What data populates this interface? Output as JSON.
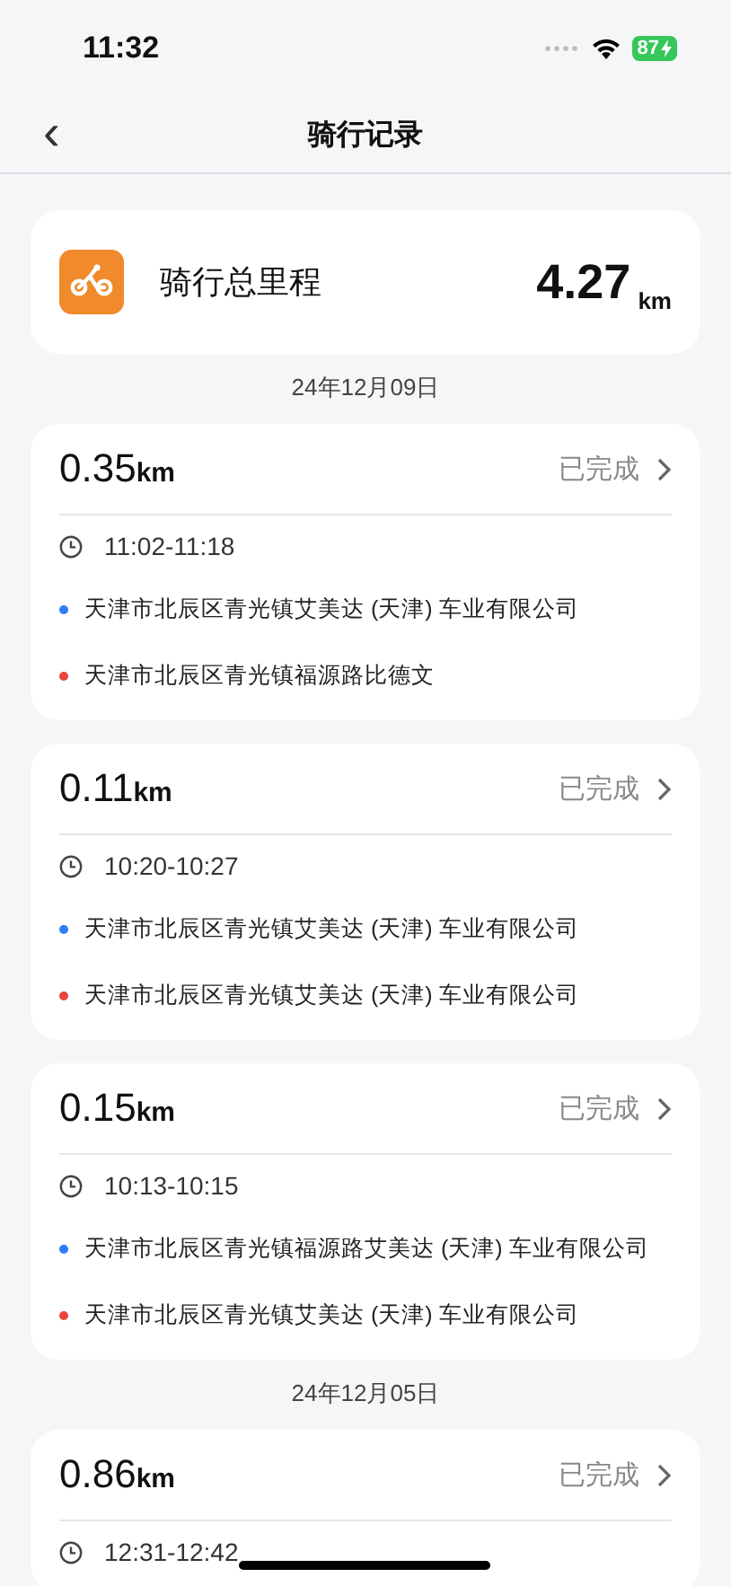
{
  "status_bar": {
    "time": "11:32",
    "battery": "87"
  },
  "nav": {
    "back": "‹",
    "title": "骑行记录"
  },
  "summary": {
    "label": "骑行总里程",
    "value": "4.27",
    "unit": "km"
  },
  "groups": [
    {
      "date": "24年12月09日",
      "trips": [
        {
          "distance": "0.35",
          "unit": "km",
          "status": "已完成",
          "time": "11:02-11:18",
          "places": [
            {
              "text": "天津市北辰区青光镇艾美达 (天津) 车业有限公司",
              "color": "#2f7cf6"
            },
            {
              "text": "天津市北辰区青光镇福源路比德文",
              "color": "#e8453c"
            }
          ]
        },
        {
          "distance": "0.11",
          "unit": "km",
          "status": "已完成",
          "time": "10:20-10:27",
          "places": [
            {
              "text": "天津市北辰区青光镇艾美达 (天津) 车业有限公司",
              "color": "#2f7cf6"
            },
            {
              "text": "天津市北辰区青光镇艾美达 (天津) 车业有限公司",
              "color": "#e8453c"
            }
          ]
        },
        {
          "distance": "0.15",
          "unit": "km",
          "status": "已完成",
          "time": "10:13-10:15",
          "places": [
            {
              "text": "天津市北辰区青光镇福源路艾美达 (天津) 车业有限公司",
              "color": "#2f7cf6"
            },
            {
              "text": "天津市北辰区青光镇艾美达 (天津) 车业有限公司",
              "color": "#e8453c"
            }
          ]
        }
      ]
    },
    {
      "date": "24年12月05日",
      "trips": [
        {
          "distance": "0.86",
          "unit": "km",
          "status": "已完成",
          "time": "12:31-12:42"
        }
      ]
    }
  ]
}
